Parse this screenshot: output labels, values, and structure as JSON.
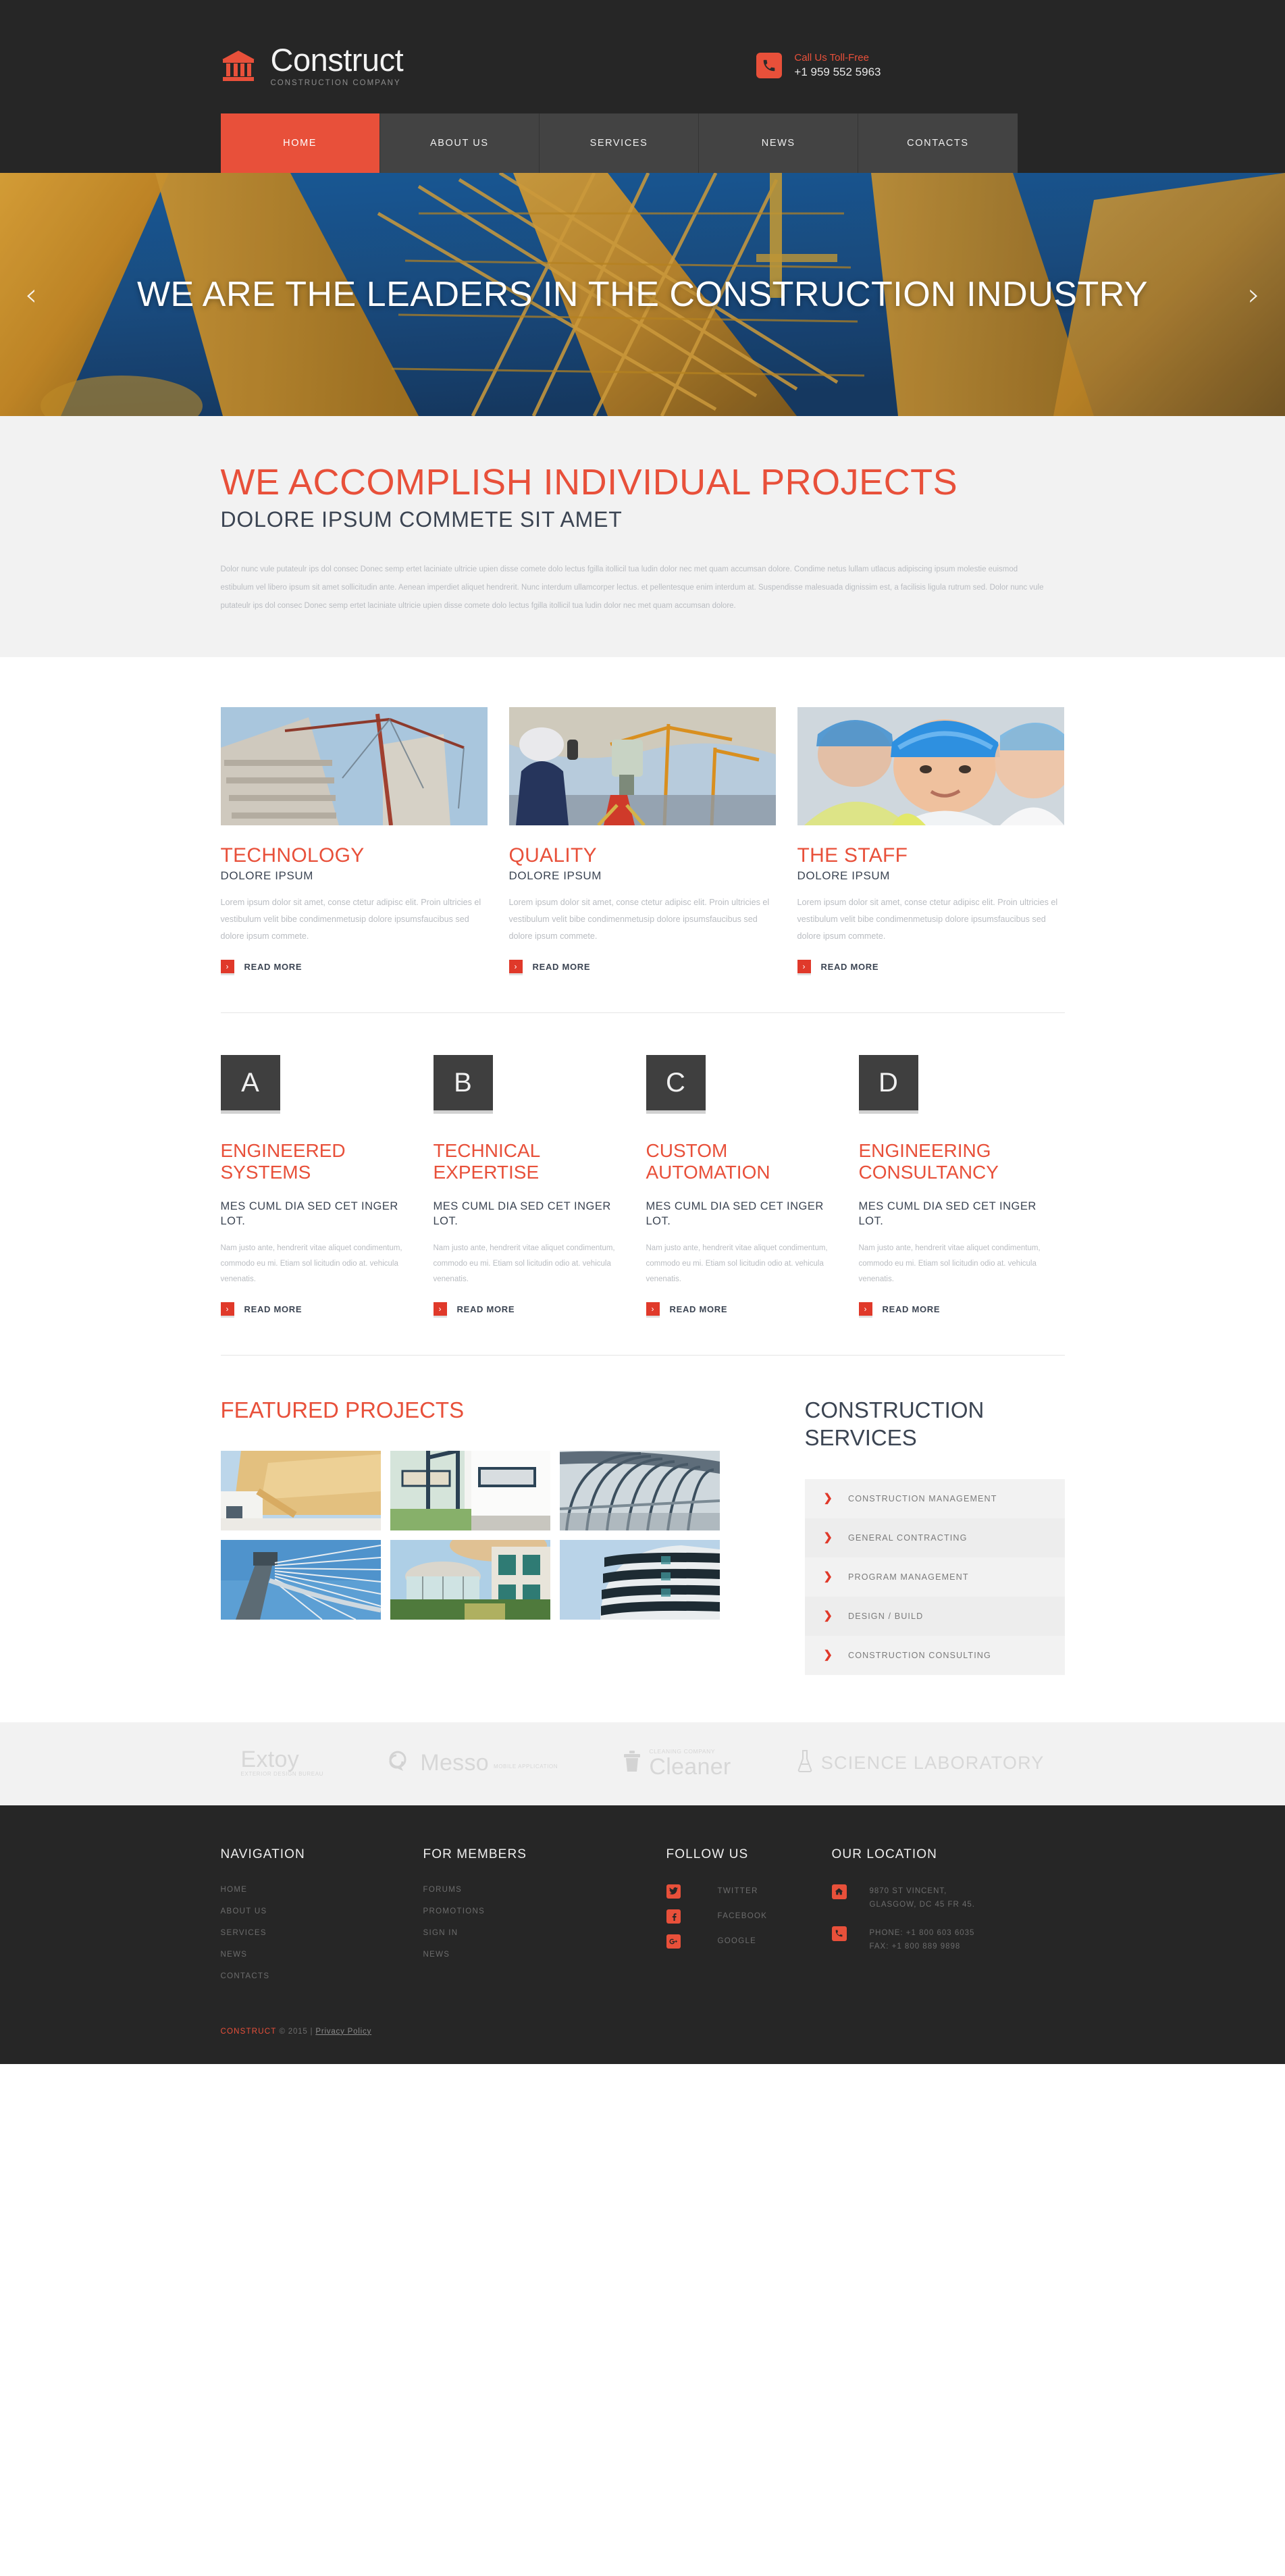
{
  "colors": {
    "accent": "#e8503a",
    "accent_dark": "#e0392a",
    "dark": "#262626",
    "nav_bg": "#434343",
    "muted": "#b9bcc1"
  },
  "header": {
    "logo_icon": "bank-building-icon",
    "brand_name": "Construct",
    "brand_tagline": "CONSTRUCTION COMPANY",
    "phone_icon": "phone-icon",
    "phone_label": "Call Us Toll-Free",
    "phone_number": "+1 959 552 5963"
  },
  "nav": {
    "items": [
      {
        "label": "HOME",
        "active": true
      },
      {
        "label": "ABOUT US",
        "active": false
      },
      {
        "label": "SERVICES",
        "active": false
      },
      {
        "label": "NEWS",
        "active": false
      },
      {
        "label": "CONTACTS",
        "active": false
      }
    ]
  },
  "hero": {
    "title": "WE ARE THE LEADERS IN THE CONSTRUCTION INDUSTRY",
    "prev_icon": "chevron-left-icon",
    "next_icon": "chevron-right-icon",
    "image_description": "orange construction crane against blue sky"
  },
  "intro": {
    "heading": "WE ACCOMPLISH INDIVIDUAL PROJECTS",
    "subheading": "DOLORE IPSUM COMMETE SIT AMET",
    "paragraph": "Dolor nunc vule putateulr ips dol consec Donec semp ertet laciniate ultricie upien disse comete dolo lectus fgilla itollicil tua ludin dolor nec met quam accumsan dolore. Condime netus lullam utlacus adipiscing ipsum molestie euismod estibulum vel libero ipsum sit amet sollicitudin ante. Aenean imperdiet aliquet hendrerit. Nunc interdum ullamcorper lectus. et pellentesque enim interdum at. Suspendisse malesuada dignissim est, a facilisis ligula rutrum sed. Dolor nunc vule putateulr ips dol consec Donec semp ertet laciniate ultricie upien disse comete dolo lectus fgilla itollicil tua ludin dolor nec met quam accumsan dolore."
  },
  "features3": {
    "read_more_label": "READ MORE",
    "read_more_icon": "chevron-right-icon",
    "items": [
      {
        "title": "TECHNOLOGY",
        "subtitle": "DOLORE IPSUM",
        "body": "Lorem ipsum dolor sit amet, conse ctetur adipisc elit. Proin ultricies el vestibulum velit bibe condimenmetusip dolore ipsumsfaucibus sed dolore ipsum commete.",
        "image_description": "high-rise building under construction with red crane"
      },
      {
        "title": "QUALITY",
        "subtitle": "DOLORE IPSUM",
        "body": "Lorem ipsum dolor sit amet, conse ctetur adipisc elit. Proin ultricies el vestibulum velit bibe condimenmetusip dolore ipsumsfaucibus sed dolore ipsum commete.",
        "image_description": "surveyor in hard hat with theodolite on site"
      },
      {
        "title": "THE STAFF",
        "subtitle": "DOLORE IPSUM",
        "body": "Lorem ipsum dolor sit amet, conse ctetur adipisc elit. Proin ultricies el vestibulum velit bibe condimenmetusip dolore ipsumsfaucibus sed dolore ipsum commete.",
        "image_description": "smiling workers in blue hard hats"
      }
    ]
  },
  "features4": {
    "read_more_label": "READ MORE",
    "read_more_icon": "chevron-right-icon",
    "items": [
      {
        "badge": "A",
        "title": "ENGINEERED SYSTEMS",
        "subtitle": "MES CUML DIA SED CET INGER LOT.",
        "body": "Nam justo ante, hendrerit vitae aliquet condimentum, commodo eu mi. Etiam sol licitudin odio at. vehicula venenatis."
      },
      {
        "badge": "B",
        "title": "TECHNICAL EXPERTISE",
        "subtitle": "MES CUML DIA SED CET INGER LOT.",
        "body": "Nam justo ante, hendrerit vitae aliquet condimentum, commodo eu mi. Etiam sol licitudin odio at. vehicula venenatis."
      },
      {
        "badge": "C",
        "title": "CUSTOM AUTOMATION",
        "subtitle": "MES CUML DIA SED CET INGER LOT.",
        "body": "Nam justo ante, hendrerit vitae aliquet condimentum, commodo eu mi. Etiam sol licitudin odio at. vehicula venenatis."
      },
      {
        "badge": "D",
        "title": "ENGINEERING CONSULTANCY",
        "subtitle": "MES CUML DIA SED CET INGER LOT.",
        "body": "Nam justo ante, hendrerit vitae aliquet condimentum, commodo eu mi. Etiam sol licitudin odio at. vehicula venenatis."
      }
    ]
  },
  "projects": {
    "title": "FEATURED PROJECTS",
    "thumbs": [
      {
        "description": "golden metal clad modern roof"
      },
      {
        "description": "white modern house glass corner window"
      },
      {
        "description": "curved glass canopy walkway"
      },
      {
        "description": "cable stayed bridge pylon"
      },
      {
        "description": "round glass residential building with pool"
      },
      {
        "description": "curved glass office tower"
      }
    ]
  },
  "services": {
    "title": "CONSTRUCTION SERVICES",
    "bullet_icon": "chevron-right-icon",
    "items": [
      "CONSTRUCTION MANAGEMENT",
      "GENERAL CONTRACTING",
      "PROGRAM MANAGEMENT",
      "DESIGN / BUILD",
      "CONSTRUCTION CONSULTING"
    ]
  },
  "partners": [
    {
      "name": "Extoy",
      "sub": "EXTERIOR DESIGN BUREAU",
      "icon": ""
    },
    {
      "name": "Messo",
      "sub": "MOBILE APPLICATION",
      "icon": "speech-bubble-icon"
    },
    {
      "name": "Cleaner",
      "over": "CLEANING COMPANY",
      "icon": "trash-bin-icon"
    },
    {
      "name": "SCIENCE LABORATORY",
      "icon": "flask-icon"
    }
  ],
  "footer": {
    "navigation": {
      "title": "NAVIGATION",
      "items": [
        "HOME",
        "ABOUT US",
        "SERVICES",
        "NEWS",
        "CONTACTS"
      ]
    },
    "members": {
      "title": "FOR MEMBERS",
      "items": [
        "FORUMS",
        "PROMOTIONS",
        "SIGN IN",
        "NEWS"
      ]
    },
    "follow": {
      "title": "FOLLOW US",
      "items": [
        {
          "label": "TWITTER",
          "icon": "twitter-icon"
        },
        {
          "label": "FACEBOOK",
          "icon": "facebook-icon"
        },
        {
          "label": "GOOGLE",
          "icon": "google-plus-icon"
        }
      ]
    },
    "location": {
      "title": "OUR LOCATION",
      "address_icon": "home-icon",
      "address": "9870 ST VINCENT,\nGLASGOW, DC 45 FR 45.",
      "phone_icon": "phone-icon",
      "phone": "PHONE: +1 800 603 6035\nFAX: +1 800 889 9898"
    },
    "copyright_name": "CONSTRUCT",
    "copyright_rest": "© 2015 |",
    "privacy_label": "Privacy Policy"
  }
}
